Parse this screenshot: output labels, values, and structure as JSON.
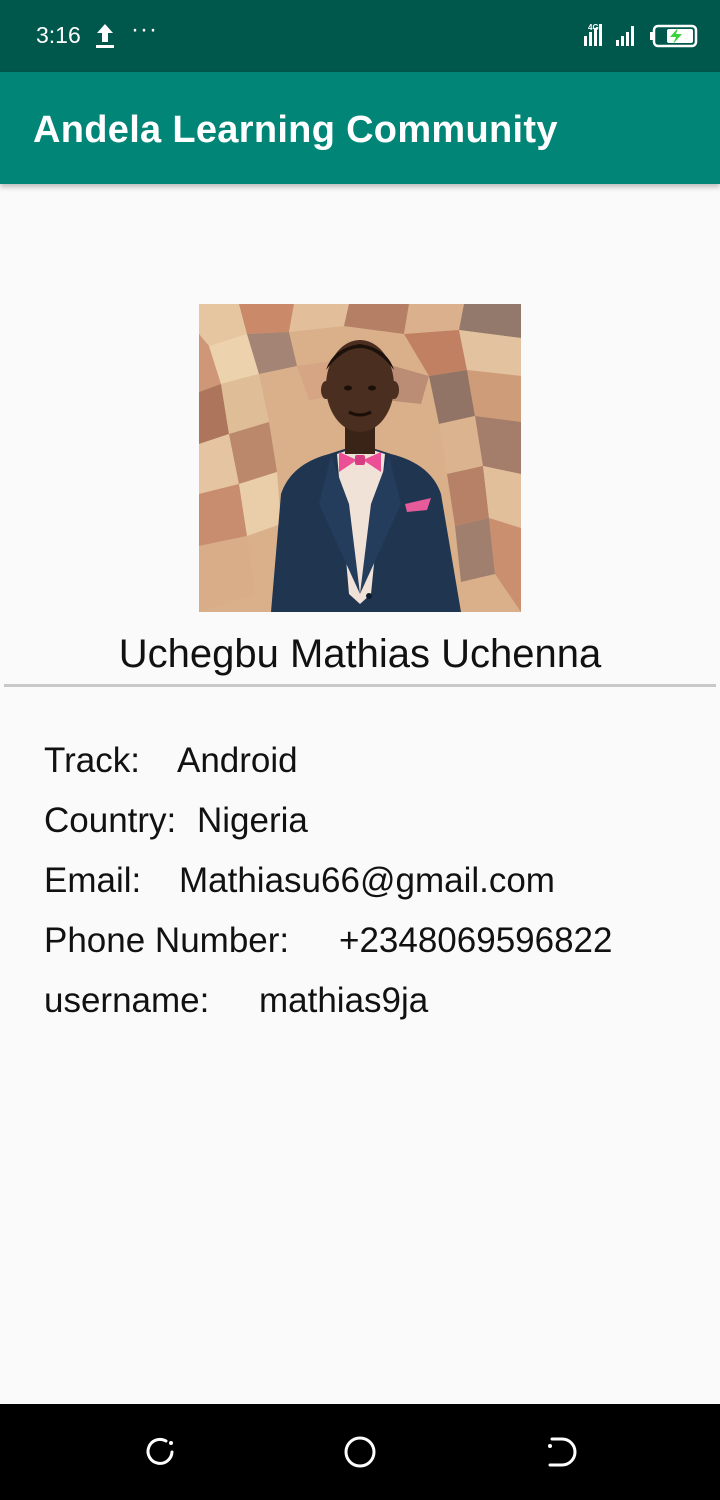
{
  "status_bar": {
    "time": "3:16",
    "upload_icon": "upload-arrow-icon",
    "more_icon": "more-dots-icon",
    "network_label": "4G",
    "battery_icon": "battery-charging-icon"
  },
  "app_bar": {
    "title": "Andela Learning Community",
    "color": "#008577"
  },
  "profile": {
    "photo_alt": "profile-photo",
    "name": "Uchegbu Mathias Uchenna"
  },
  "details": [
    {
      "label": "Track:",
      "value": "Android"
    },
    {
      "label": "Country:",
      "value": "Nigeria"
    },
    {
      "label": "Email:",
      "value": "Mathiasu66@gmail.com"
    },
    {
      "label": "Phone Number:",
      "value": "+2348069596822"
    },
    {
      "label": "username:",
      "value": "mathias9ja"
    }
  ],
  "nav_bar": {
    "recent_icon": "recent-apps-icon",
    "home_icon": "home-circle-icon",
    "back_icon": "back-icon"
  }
}
